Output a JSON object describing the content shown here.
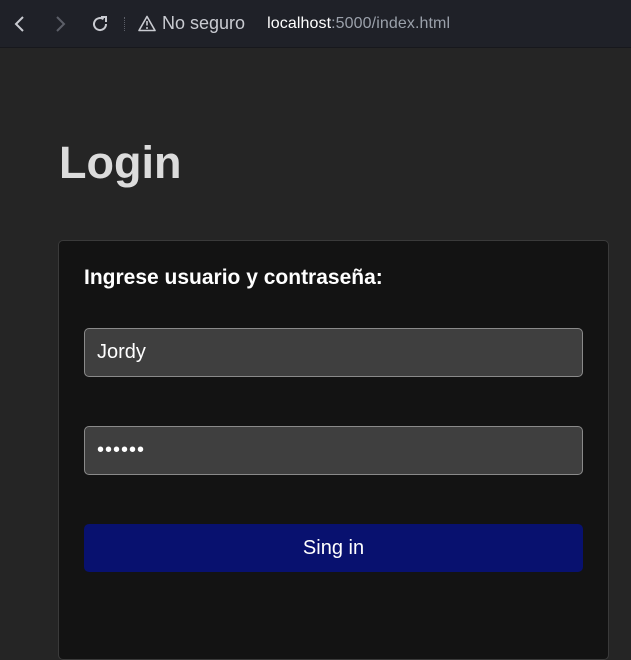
{
  "browser": {
    "security_label": "No seguro",
    "url_host": "localhost",
    "url_rest": ":5000/index.html"
  },
  "page": {
    "title": "Login"
  },
  "form": {
    "heading": "Ingrese usuario y contraseña:",
    "username_value": "Jordy",
    "password_value": "••••••",
    "submit_label": "Sing in"
  },
  "colors": {
    "button_bg": "#08116f",
    "page_bg": "#252525",
    "card_bg": "#131313",
    "input_bg": "#3f3f3f"
  }
}
